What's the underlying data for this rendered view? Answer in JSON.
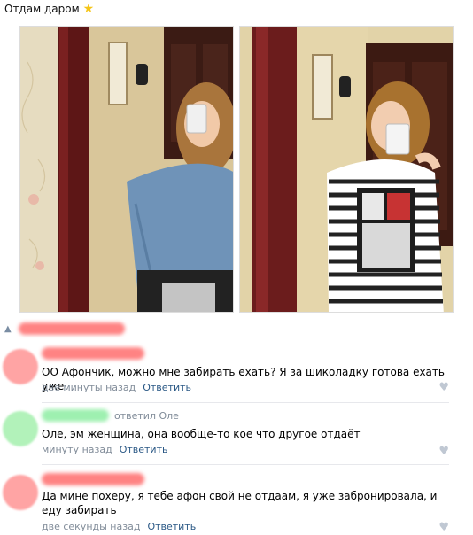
{
  "post": {
    "title": "Отдам даром",
    "title_icon": "star-icon",
    "accent_color": "#f5c518"
  },
  "reply_row": {
    "icon": "reply-arrow-icon"
  },
  "comments": [
    {
      "text": "ОО Афончик, можно мне забирать ехать? Я за шиколадку готова ехать уже",
      "time": "две минуты назад",
      "reply_label": "Ответить",
      "reply_to": ""
    },
    {
      "text": "Оле, эм женщина, она вообще-то кое что другое отдаёт",
      "time": "минуту назад",
      "reply_label": "Ответить",
      "reply_to": "ответил Оле"
    },
    {
      "text": "Да мине похеру, я тебе афон свой не отдаам, я уже забронировала, и еду забирать",
      "time": "две секунды назад",
      "reply_label": "Ответить",
      "reply_to": ""
    }
  ],
  "colors": {
    "link": "#2a5885",
    "meta": "#818c99",
    "blur_red": "#ff8383",
    "blur_green": "#9ef0b0"
  }
}
